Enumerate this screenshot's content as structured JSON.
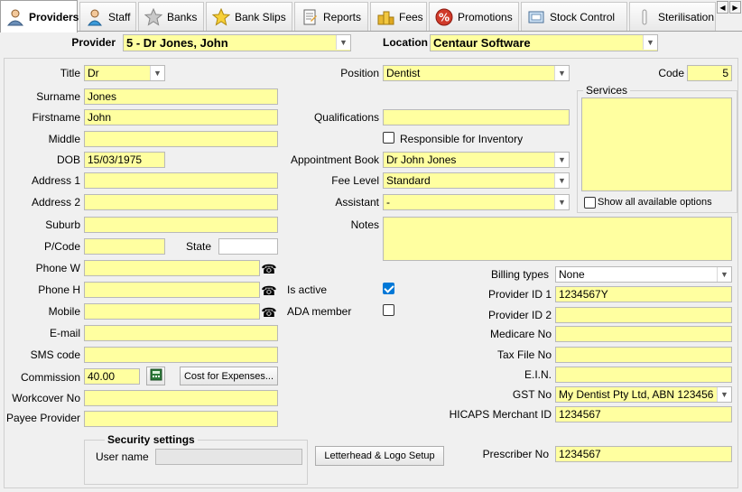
{
  "tabs": [
    {
      "label": "Providers",
      "icon": "person-icon",
      "active": true
    },
    {
      "label": "Staff",
      "icon": "staff-person-icon"
    },
    {
      "label": "Banks",
      "icon": "star-icon"
    },
    {
      "label": "Bank Slips",
      "icon": "yellow-star-icon"
    },
    {
      "label": "Reports",
      "icon": "report-icon"
    },
    {
      "label": "Fees",
      "icon": "coins-icon"
    },
    {
      "label": "Promotions",
      "icon": "percent-icon"
    },
    {
      "label": "Stock Control",
      "icon": "stock-icon"
    },
    {
      "label": "Sterilisation",
      "icon": "sterilisation-icon"
    }
  ],
  "header": {
    "provider_label": "Provider",
    "provider_value": "5 - Dr Jones, John",
    "location_label": "Location",
    "location_value": "Centaur Software"
  },
  "form": {
    "title_label": "Title",
    "title_value": "Dr",
    "surname_label": "Surname",
    "surname_value": "Jones",
    "firstname_label": "Firstname",
    "firstname_value": "John",
    "middle_label": "Middle",
    "middle_value": "",
    "dob_label": "DOB",
    "dob_value": "15/03/1975",
    "address1_label": "Address 1",
    "address1_value": "",
    "address2_label": "Address 2",
    "address2_value": "",
    "suburb_label": "Suburb",
    "suburb_value": "",
    "pcode_label": "P/Code",
    "pcode_value": "",
    "state_label": "State",
    "state_value": "",
    "phonew_label": "Phone W",
    "phonew_value": "",
    "phoneh_label": "Phone H",
    "phoneh_value": "",
    "mobile_label": "Mobile",
    "mobile_value": "",
    "email_label": "E-mail",
    "email_value": "",
    "sms_label": "SMS code",
    "sms_value": "",
    "commission_label": "Commission",
    "commission_value": "40.00",
    "cost_expenses_label": "Cost for Expenses...",
    "workcover_label": "Workcover No",
    "workcover_value": "",
    "payee_label": "Payee Provider",
    "payee_value": "",
    "position_label": "Position",
    "position_value": "Dentist",
    "qualifications_label": "Qualifications",
    "qualifications_value": "",
    "responsible_label": "Responsible for Inventory",
    "responsible_checked": false,
    "appt_book_label": "Appointment Book",
    "appt_book_value": "Dr John Jones",
    "fee_level_label": "Fee Level",
    "fee_level_value": "Standard",
    "assistant_label": "Assistant",
    "assistant_value": "-",
    "notes_label": "Notes",
    "notes_value": "",
    "is_active_label": "Is active",
    "is_active_checked": true,
    "ada_member_label": "ADA member",
    "ada_member_checked": false,
    "code_label": "Code",
    "code_value": "5",
    "services_label": "Services",
    "show_all_label": "Show all available options",
    "show_all_checked": false,
    "billing_types_label": "Billing types",
    "billing_types_value": "None",
    "provider_id1_label": "Provider ID 1",
    "provider_id1_value": "1234567Y",
    "provider_id2_label": "Provider ID 2",
    "provider_id2_value": "",
    "medicare_label": "Medicare No",
    "medicare_value": "",
    "tax_file_label": "Tax File No",
    "tax_file_value": "",
    "ein_label": "E.I.N.",
    "ein_value": "",
    "gst_label": "GST No",
    "gst_value": "My Dentist Pty Ltd, ABN 123456",
    "hicaps_label": "HICAPS Merchant ID",
    "hicaps_value": "1234567",
    "prescriber_label": "Prescriber No",
    "prescriber_value": "1234567"
  },
  "security": {
    "title": "Security settings",
    "username_label": "User name",
    "username_value": ""
  },
  "letterhead_button": "Letterhead & Logo Setup",
  "colors": {
    "field_bg": "#ffffa0",
    "accent": "#0078d7"
  }
}
